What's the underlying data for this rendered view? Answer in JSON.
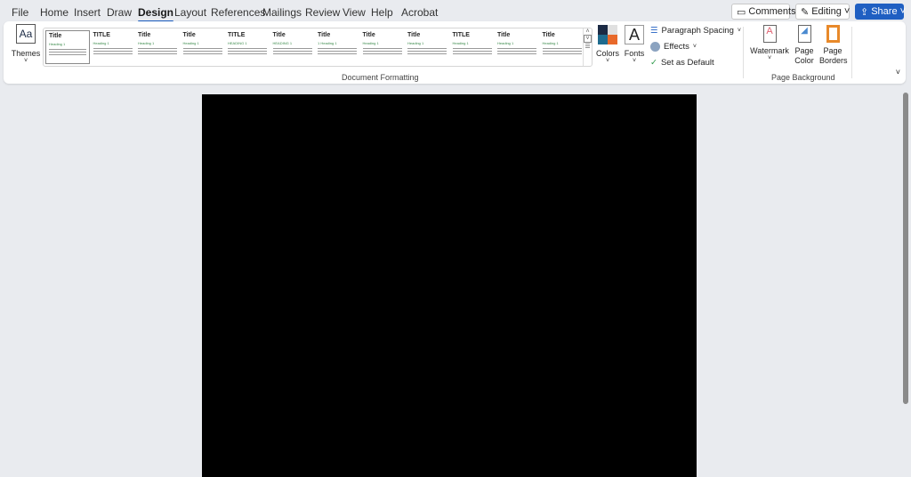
{
  "menu": {
    "tabs": [
      "File",
      "Home",
      "Insert",
      "Draw",
      "Design",
      "Layout",
      "References",
      "Mailings",
      "Review",
      "View",
      "Help",
      "Acrobat"
    ],
    "active": "Design"
  },
  "top_buttons": {
    "comments": "Comments",
    "editing": "Editing",
    "share": "Share"
  },
  "ribbon": {
    "themes_label": "Themes",
    "themes_icon_text": "Aa",
    "style_set_thumbs": [
      {
        "title": "Title",
        "heading": "Heading 1"
      },
      {
        "title": "TITLE",
        "heading": "Heading 1"
      },
      {
        "title": "Title",
        "heading": "Heading 1"
      },
      {
        "title": "Title",
        "heading": "Heading 1"
      },
      {
        "title": "TITLE",
        "heading": "HEADING 1"
      },
      {
        "title": "Title",
        "heading": "HEADING 1"
      },
      {
        "title": "Title",
        "heading": "1 Heading 1"
      },
      {
        "title": "Title",
        "heading": "Heading 1"
      },
      {
        "title": "Title",
        "heading": "Heading 1"
      },
      {
        "title": "TITLE",
        "heading": "Heading 1"
      },
      {
        "title": "Title",
        "heading": "Heading 1"
      },
      {
        "title": "Title",
        "heading": "Heading 1"
      }
    ],
    "colors_label": "Colors",
    "fonts_label": "Fonts",
    "fonts_icon_text": "A",
    "paragraph_spacing": "Paragraph Spacing",
    "effects": "Effects",
    "set_default": "Set as Default",
    "group_document_formatting": "Document Formatting",
    "watermark": "Watermark",
    "page_color": "Page Color",
    "page_borders": "Page Borders",
    "group_page_background": "Page Background",
    "colors": {
      "accent": "#185abd",
      "swatch": [
        "#1b2a44",
        "#e0e0e0",
        "#1f6b8e",
        "#e8692a"
      ]
    }
  }
}
